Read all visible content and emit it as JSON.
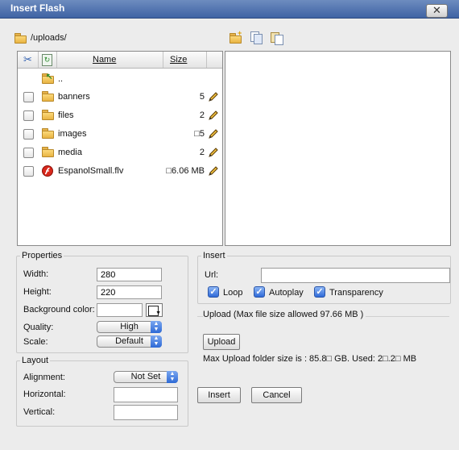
{
  "window": {
    "title": "Insert Flash",
    "close_label": "✕"
  },
  "path": {
    "current": "/uploads/"
  },
  "file_list": {
    "columns": {
      "name": "Name",
      "size": "Size"
    },
    "parent_label": "..",
    "rows": [
      {
        "name": "banners",
        "size": "5",
        "type": "folder"
      },
      {
        "name": "files",
        "size": "2",
        "type": "folder"
      },
      {
        "name": "images",
        "size": "□5",
        "type": "folder"
      },
      {
        "name": "media",
        "size": "2",
        "type": "folder"
      },
      {
        "name": "EspanolSmall.flv",
        "size": "□6.06 MB",
        "type": "flash"
      }
    ]
  },
  "properties": {
    "legend": "Properties",
    "width_label": "Width:",
    "width_value": "280",
    "height_label": "Height:",
    "height_value": "220",
    "bgcolor_label": "Background color:",
    "bgcolor_value": "",
    "quality_label": "Quality:",
    "quality_value": "High",
    "scale_label": "Scale:",
    "scale_value": "Default"
  },
  "layout": {
    "legend": "Layout",
    "alignment_label": "Alignment:",
    "alignment_value": "Not Set",
    "horizontal_label": "Horizontal:",
    "horizontal_value": "",
    "vertical_label": "Vertical:",
    "vertical_value": ""
  },
  "insert": {
    "legend": "Insert",
    "url_label": "Url:",
    "url_value": "",
    "loop_label": "Loop",
    "autoplay_label": "Autoplay",
    "transparency_label": "Transparency"
  },
  "upload": {
    "legend": "Upload (Max file size allowed 97.66 MB )",
    "button_label": "Upload",
    "folder_info": "Max Upload folder size is : 85.8□ GB. Used: 2□.2□ MB"
  },
  "actions": {
    "insert_label": "Insert",
    "cancel_label": "Cancel"
  }
}
